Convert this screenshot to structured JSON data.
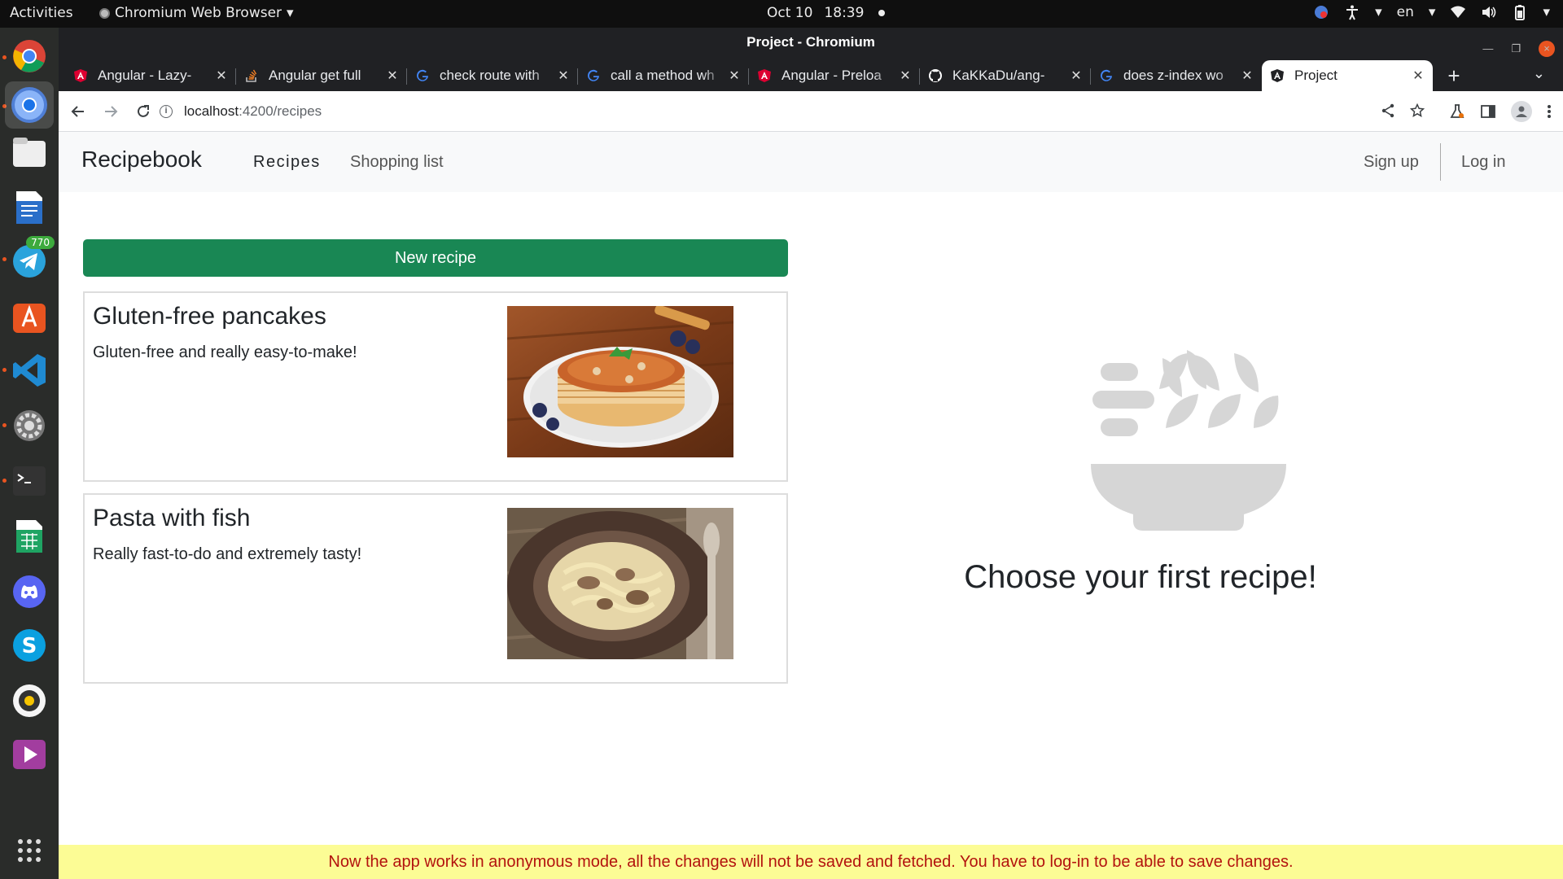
{
  "system": {
    "activities": "Activities",
    "app_name": "Chromium Web Browser",
    "date": "Oct 10",
    "time": "18:39",
    "language": "en"
  },
  "dock": {
    "items": [
      {
        "name": "chrome-icon",
        "running": true
      },
      {
        "name": "chromium-icon",
        "running": true,
        "active": true
      },
      {
        "name": "files-icon",
        "running": false
      },
      {
        "name": "writer-icon",
        "running": false
      },
      {
        "name": "telegram-icon",
        "running": true,
        "badge": "770"
      },
      {
        "name": "software-center-icon",
        "running": false
      },
      {
        "name": "vscode-icon",
        "running": true
      },
      {
        "name": "settings-icon",
        "running": true
      },
      {
        "name": "terminal-icon",
        "running": true
      },
      {
        "name": "calc-icon",
        "running": false
      },
      {
        "name": "discord-icon",
        "running": false
      },
      {
        "name": "skype-icon",
        "running": false
      },
      {
        "name": "rhythmbox-icon",
        "running": false
      },
      {
        "name": "video-icon",
        "running": false
      },
      {
        "name": "app-grid-icon",
        "running": false
      }
    ]
  },
  "window": {
    "title": "Project - Chromium"
  },
  "tabs": [
    {
      "title": "Angular - Lazy-",
      "favicon": "angular",
      "active": false
    },
    {
      "title": "Angular get full",
      "favicon": "stackoverflow",
      "active": false
    },
    {
      "title": "check route with",
      "favicon": "google",
      "active": false
    },
    {
      "title": "call a method wh",
      "favicon": "google",
      "active": false
    },
    {
      "title": "Angular - Preloa",
      "favicon": "angular",
      "active": false
    },
    {
      "title": "KaKKaDu/ang-",
      "favicon": "github",
      "active": false
    },
    {
      "title": "does z-index wo",
      "favicon": "google",
      "active": false
    },
    {
      "title": "Project",
      "favicon": "angular-dark",
      "active": true
    }
  ],
  "address": {
    "host": "localhost",
    "path": ":4200/recipes"
  },
  "app": {
    "brand": "Recipebook",
    "nav": {
      "recipes": "Recipes",
      "shopping_list": "Shopping list",
      "sign_up": "Sign up",
      "log_in": "Log in"
    },
    "new_recipe_label": "New recipe",
    "recipes": [
      {
        "name": "Gluten-free pancakes",
        "description": "Gluten-free and really easy-to-make!"
      },
      {
        "name": "Pasta with fish",
        "description": "Really fast-to-do and extremely tasty!"
      }
    ],
    "empty_state": "Choose your first recipe!",
    "banner": "Now the app works in anonymous mode, all the changes will not be saved and fetched. You have to log-in to be able to save changes."
  },
  "colors": {
    "primary_button": "#198754",
    "banner_bg": "#fcfc95",
    "banner_text": "#b3120e",
    "placeholder_icon": "#d6d6d6"
  }
}
